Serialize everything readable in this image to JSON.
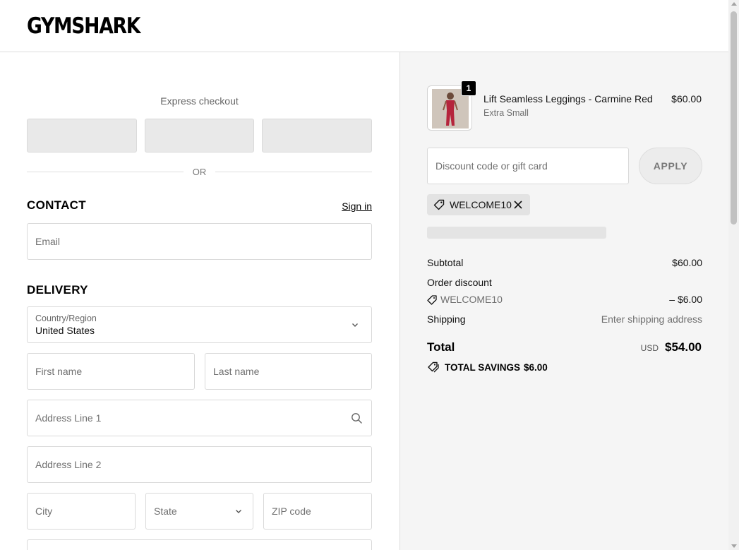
{
  "brand": {
    "logo_text": "GYMSHARK"
  },
  "express": {
    "title": "Express checkout",
    "divider": "OR"
  },
  "contact": {
    "title": "CONTACT",
    "signin": "Sign in",
    "email_placeholder": "Email"
  },
  "delivery": {
    "title": "DELIVERY",
    "country_label": "Country/Region",
    "country_value": "United States",
    "first_name_placeholder": "First name",
    "last_name_placeholder": "Last name",
    "address1_placeholder": "Address Line 1",
    "address2_placeholder": "Address Line 2",
    "city_placeholder": "City",
    "state_placeholder": "State",
    "zip_placeholder": "ZIP code"
  },
  "cart": {
    "item": {
      "quantity": "1",
      "name": "Lift Seamless Leggings - Carmine Red",
      "variant": "Extra Small",
      "price": "$60.00"
    },
    "discount": {
      "placeholder": "Discount code or gift card",
      "apply_label": "APPLY"
    },
    "applied_code": "WELCOME10"
  },
  "summary": {
    "subtotal_label": "Subtotal",
    "subtotal_value": "$60.00",
    "order_discount_label": "Order discount",
    "discount_code": "WELCOME10",
    "discount_value": "– $6.00",
    "shipping_label": "Shipping",
    "shipping_value": "Enter shipping address",
    "total_label": "Total",
    "currency": "USD",
    "total_value": "$54.00",
    "savings_label": "TOTAL SAVINGS",
    "savings_value": "$6.00"
  },
  "colors": {
    "accent": "#000000",
    "summary_bg": "#f5f5f5",
    "button_bg": "#e9e9e9",
    "product_red": "#b5243c"
  },
  "icons": [
    "chevron-down-icon",
    "search-icon",
    "tag-icon",
    "close-icon",
    "scroll-up-arrow",
    "scroll-down-arrow"
  ]
}
